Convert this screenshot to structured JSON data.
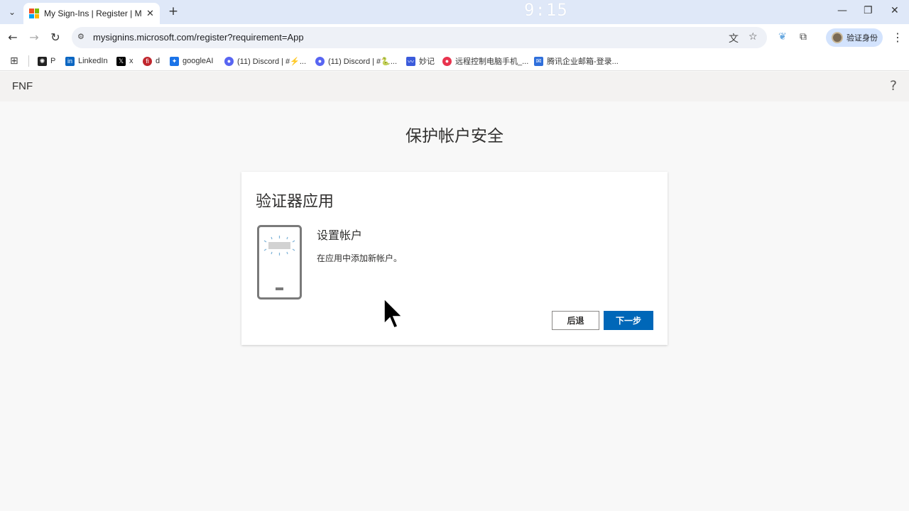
{
  "browser": {
    "tab": {
      "title": "My Sign-Ins | Register | Microsoft"
    },
    "clock": "9:15",
    "url": "mysignins.microsoft.com/register?requirement=App",
    "profile_label": "验证身份",
    "bookmarks": [
      {
        "label": "P",
        "icon": "chatgpt-icon",
        "color": "#222222"
      },
      {
        "label": "LinkedIn",
        "icon": "linkedin-icon",
        "color": "#0a66c2"
      },
      {
        "label": "x",
        "icon": "x-icon",
        "color": "#000000"
      },
      {
        "label": "d",
        "icon": "d-icon",
        "color": "#c0262d"
      },
      {
        "label": "googleAI",
        "icon": "googleai-icon",
        "color": "#1a73e8"
      },
      {
        "label": "(11) Discord | #⚡...",
        "icon": "discord-icon",
        "color": "#5865f2"
      },
      {
        "label": "(11) Discord | #🐍...",
        "icon": "discord-icon",
        "color": "#5865f2"
      },
      {
        "label": "妙记",
        "icon": "miaoji-icon",
        "color": "#3b5bdb"
      },
      {
        "label": "远程控制电脑手机_...",
        "icon": "remote-control-icon",
        "color": "#e8344e"
      },
      {
        "label": "腾讯企业邮箱-登录...",
        "icon": "mail-icon",
        "color": "#2f6fdb"
      }
    ]
  },
  "page": {
    "org_name": "FNF",
    "title": "保护帐户安全",
    "card": {
      "title": "验证器应用",
      "step_title": "设置帐户",
      "step_desc": "在应用中添加新帐户。",
      "back_label": "后退",
      "next_label": "下一步"
    }
  }
}
